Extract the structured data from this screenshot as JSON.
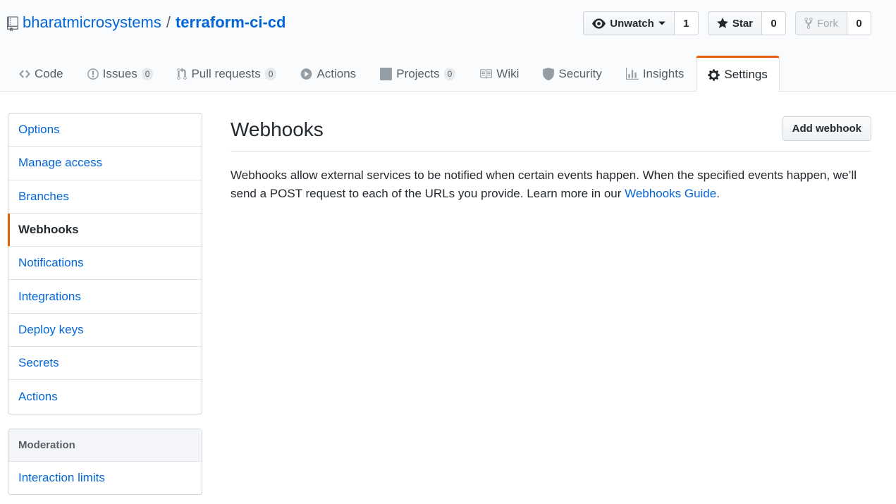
{
  "repo": {
    "owner": "bharatmicrosystems",
    "separator": "/",
    "name": "terraform-ci-cd"
  },
  "actions": {
    "watch": {
      "label": "Unwatch",
      "count": "1"
    },
    "star": {
      "label": "Star",
      "count": "0"
    },
    "fork": {
      "label": "Fork",
      "count": "0"
    }
  },
  "nav": {
    "code": "Code",
    "issues": "Issues",
    "issues_count": "0",
    "pulls": "Pull requests",
    "pulls_count": "0",
    "actions": "Actions",
    "projects": "Projects",
    "projects_count": "0",
    "wiki": "Wiki",
    "security": "Security",
    "insights": "Insights",
    "settings": "Settings"
  },
  "sidebar": {
    "items": [
      "Options",
      "Manage access",
      "Branches",
      "Webhooks",
      "Notifications",
      "Integrations",
      "Deploy keys",
      "Secrets",
      "Actions"
    ],
    "moderation_heading": "Moderation",
    "moderation_items": [
      "Interaction limits"
    ]
  },
  "main": {
    "title": "Webhooks",
    "add_button": "Add webhook",
    "description": "Webhooks allow external services to be notified when certain events happen. When the specified events happen, we’ll send a POST request to each of the URLs you provide. Learn more in our ",
    "guide_link": "Webhooks Guide",
    "description_end": "."
  },
  "colors": {
    "accent": "#e36209",
    "link": "#0366d6",
    "text": "#24292e"
  }
}
